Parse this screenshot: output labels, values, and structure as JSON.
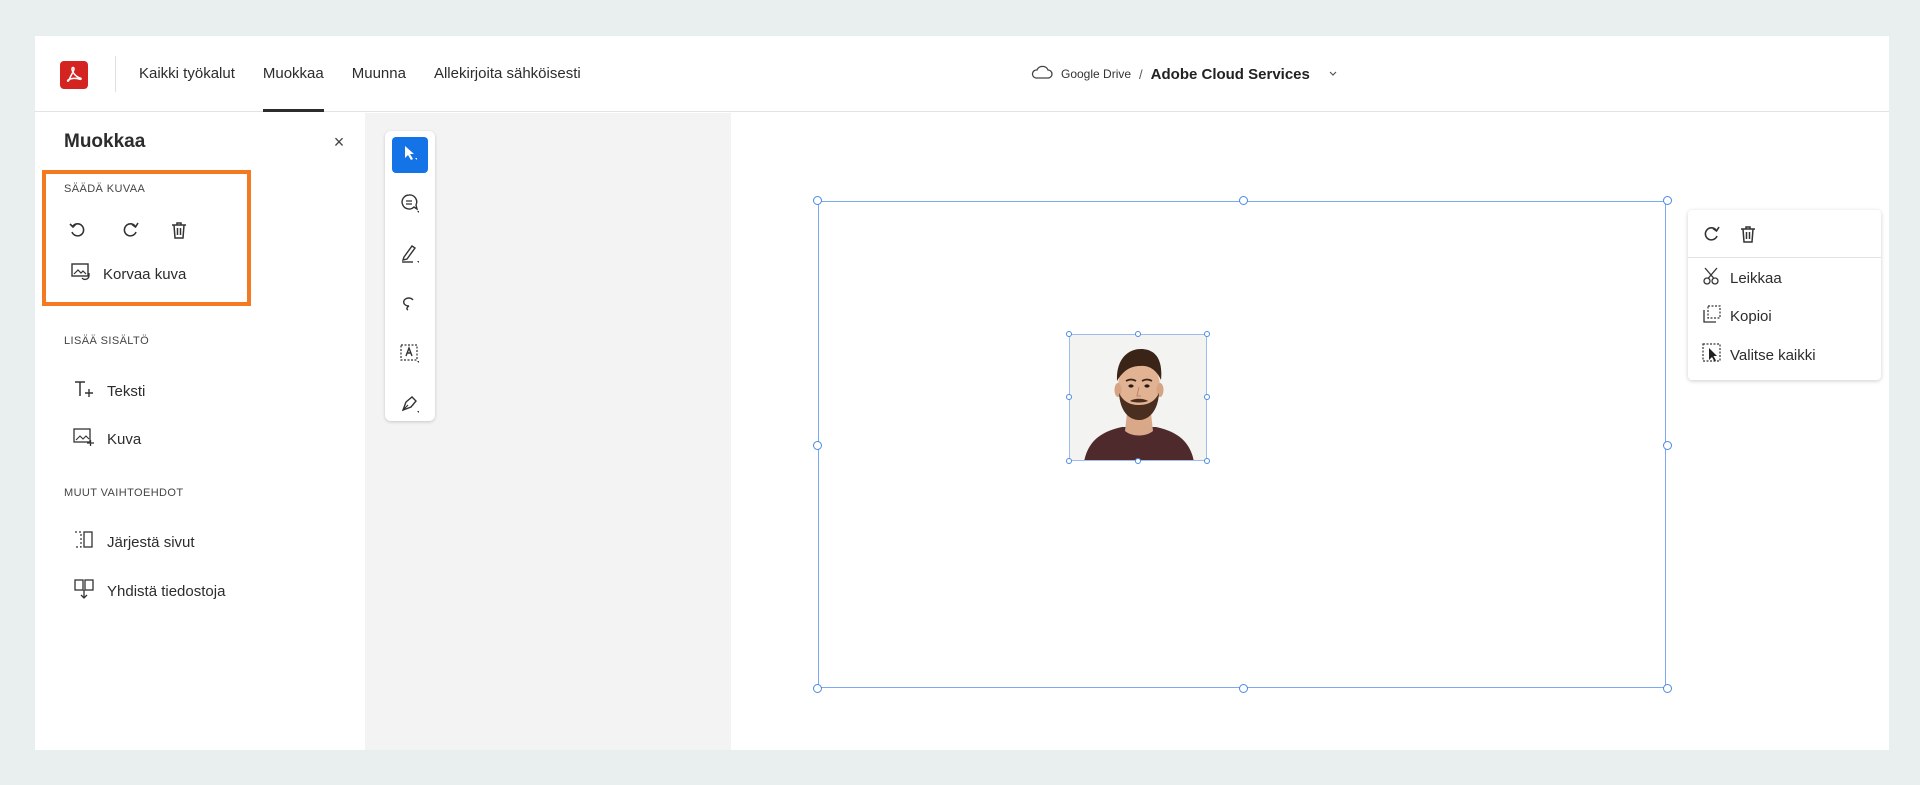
{
  "topbar": {
    "logo": "adobe-acrobat-logo",
    "nav": [
      "Kaikki työkalut",
      "Muokkaa",
      "Muunna",
      "Allekirjoita sähköisesti"
    ],
    "active_nav": "Muokkaa",
    "breadcrumb": {
      "location": "Google Drive",
      "separator": "/",
      "document": "Adobe Cloud Services"
    }
  },
  "panel": {
    "title": "Muokkaa",
    "close": "×",
    "sections": {
      "adjust_image": "SÄÄDÄ KUVAA",
      "replace_image": "Korvaa kuva",
      "add_content": "LISÄÄ SISÄLTÖ",
      "text": "Teksti",
      "image": "Kuva",
      "other_options": "MUUT VAIHTOEHDOT",
      "organize_pages": "Järjestä sivut",
      "combine_files": "Yhdistä tiedostoja"
    }
  },
  "context_menu": {
    "items": [
      "Leikkaa",
      "Kopioi",
      "Valitse kaikki"
    ]
  },
  "colors": {
    "accent": "#1473e6",
    "brand": "#d42421",
    "highlight": "#f47a21",
    "selection": "#4a8ae8"
  }
}
